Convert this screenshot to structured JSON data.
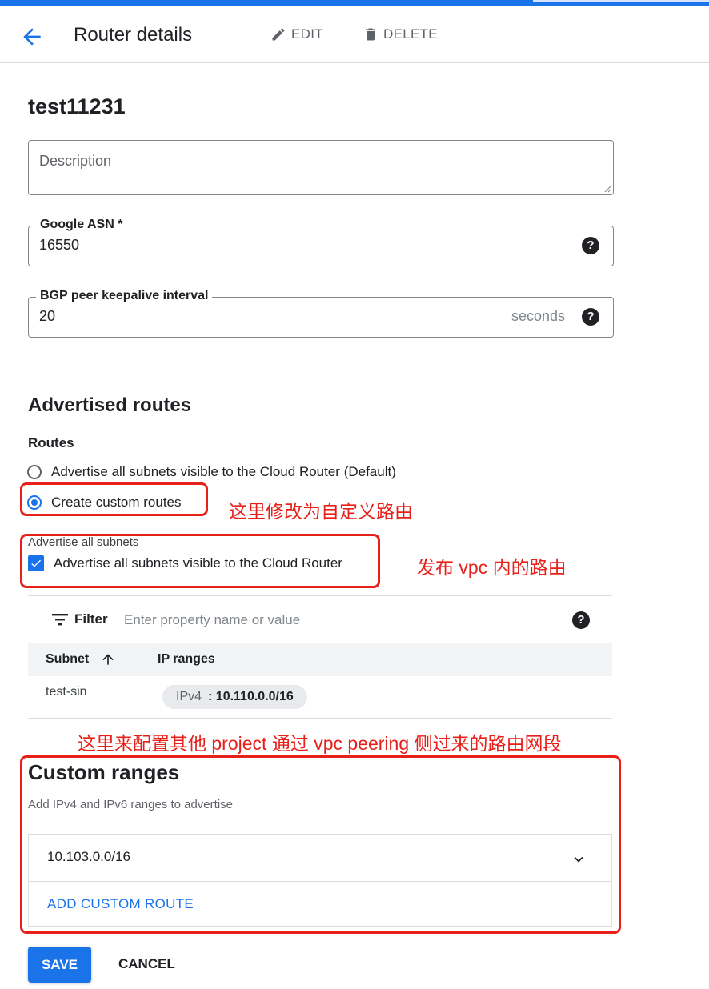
{
  "header": {
    "title": "Router details",
    "edit_label": "EDIT",
    "delete_label": "DELETE"
  },
  "router": {
    "name": "test11231"
  },
  "description": {
    "placeholder": "Description"
  },
  "asn": {
    "label": "Google ASN *",
    "value": "16550"
  },
  "keepalive": {
    "label": "BGP peer keepalive interval",
    "value": "20",
    "suffix": "seconds"
  },
  "advertised": {
    "title": "Advertised routes",
    "routes_label": "Routes",
    "options": [
      {
        "label": "Advertise all subnets visible to the Cloud Router (Default)",
        "selected": false
      },
      {
        "label": "Create custom routes",
        "selected": true
      }
    ],
    "subnets_section_label": "Advertise all subnets",
    "subnets_checkbox_label": "Advertise all subnets visible to the Cloud Router",
    "subnets_checked": true
  },
  "filter": {
    "label": "Filter",
    "placeholder": "Enter property name or value"
  },
  "table": {
    "columns": [
      "Subnet",
      "IP ranges"
    ],
    "rows": [
      {
        "subnet": "test-sin",
        "ip_type": "IPv4",
        "ip_range": ": 10.110.0.0/16"
      }
    ]
  },
  "custom_ranges": {
    "title": "Custom ranges",
    "subtitle": "Add IPv4 and IPv6 ranges to advertise",
    "ranges": [
      "10.103.0.0/16"
    ],
    "add_label": "ADD CUSTOM ROUTE"
  },
  "actions": {
    "save_label": "SAVE",
    "cancel_label": "CANCEL"
  },
  "annotations": {
    "custom_routes": "这里修改为自定义路由",
    "publish_vpc": "发布 vpc 内的路由",
    "peering": "这里来配置其他 project 通过 vpc peering 侧过来的路由网段"
  },
  "colors": {
    "accent": "#1a73e8",
    "annotation": "#e8201a"
  }
}
